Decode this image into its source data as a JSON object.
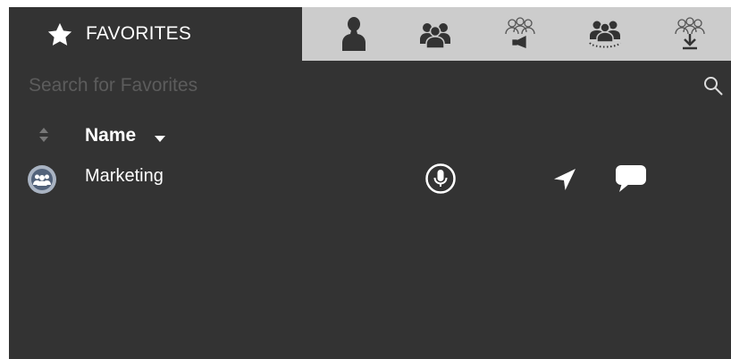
{
  "tabs": {
    "active_label": "FAVORITES",
    "icons": [
      "contact-icon",
      "group-icon",
      "broadcast-group-icon",
      "dynamic-group-icon",
      "download-group-icon"
    ]
  },
  "search": {
    "placeholder": "Search for Favorites",
    "value": ""
  },
  "list": {
    "column_header": "Name",
    "items": [
      {
        "label": "Marketing",
        "avatar": "group-avatar-icon"
      }
    ]
  },
  "colors": {
    "background": "#333333",
    "tab_inactive": "#cccccc",
    "text": "#ffffff",
    "placeholder": "#5c5c5c"
  }
}
